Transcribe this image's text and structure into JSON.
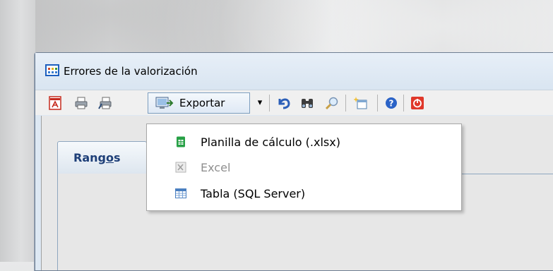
{
  "window": {
    "title": "Errores de la valorización"
  },
  "toolbar": {
    "export_label": "Exportar",
    "export_arrow": "▾",
    "icons": [
      "pdf-icon",
      "print-icon",
      "print-preview-icon",
      "export-icon",
      "undo-icon",
      "find-icon",
      "search-icon",
      "new-icon",
      "help-icon",
      "close-icon"
    ]
  },
  "tabs": [
    {
      "label_prefix": "Rang",
      "label_underline": "o",
      "label_suffix": "s"
    }
  ],
  "menu": {
    "items": [
      {
        "label": "Planilla de cálculo (.xlsx)",
        "icon": "spreadsheet-icon",
        "enabled": true
      },
      {
        "label": "Excel",
        "icon": "excel-icon",
        "enabled": false
      },
      {
        "label": "Tabla (SQL Server)",
        "icon": "table-icon",
        "enabled": true
      }
    ]
  },
  "colors": {
    "title_bg": "#dde8f3",
    "accent_blue": "#1d5fbf",
    "tab_text": "#1e3f78",
    "disabled_text": "#8f8f8f"
  }
}
